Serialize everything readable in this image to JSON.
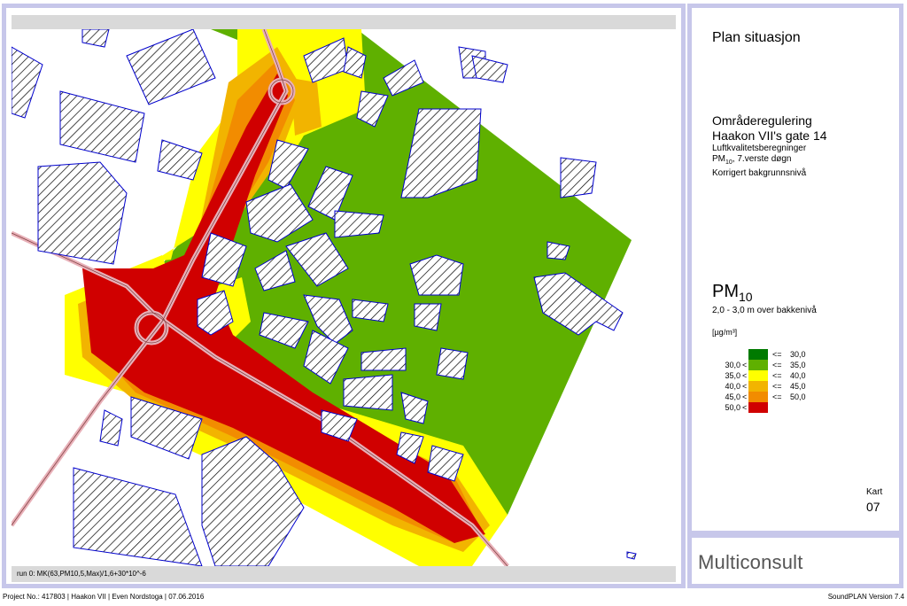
{
  "map": {
    "run_label": "run 0: MK(63,PM10,5,Max)/1,6+30*10^-6",
    "colors": {
      "class_1": "#007a00",
      "class_2": "#5fb000",
      "class_3": "#ffff00",
      "class_4": "#f2b400",
      "class_5": "#f28c00",
      "class_6": "#d00000",
      "building_outline": "#0000cc",
      "road": "#e8b0b8"
    }
  },
  "info": {
    "plan_title": "Plan situasjon",
    "project_title_line1": "Områderegulering",
    "project_title_line2": "Haakon VII's gate 14",
    "subtitle1": "Luftkvalitetsberegninger",
    "subtitle2_main": "PM",
    "subtitle2_sub": "10",
    "subtitle2_rest": ", 7.verste døgn",
    "subtitle3": "Korrigert bakgrunnsnivå",
    "pm_main": "PM",
    "pm_sub": "10",
    "height": "2,0 - 3,0 m over bakkenivå",
    "unit": "[µg/m³]",
    "kart_label": "Kart",
    "kart_number": "07"
  },
  "legend": [
    {
      "low": "",
      "lt": "",
      "color": "#007a00",
      "le": "<=",
      "high": "30,0"
    },
    {
      "low": "30,0",
      "lt": "<",
      "color": "#5fb000",
      "le": "<=",
      "high": "35,0"
    },
    {
      "low": "35,0",
      "lt": "<",
      "color": "#ffff00",
      "le": "<=",
      "high": "40,0"
    },
    {
      "low": "40,0",
      "lt": "<",
      "color": "#f2b400",
      "le": "<=",
      "high": "45,0"
    },
    {
      "low": "45,0",
      "lt": "<",
      "color": "#f28c00",
      "le": "<=",
      "high": "50,0"
    },
    {
      "low": "50,0",
      "lt": "<",
      "color": "#d00000",
      "le": "",
      "high": ""
    }
  ],
  "logo": "Multiconsult",
  "footer": {
    "left": "Project No.: 417803 | Haakon VII | Even Nordstoga | 07.06.2016",
    "right": "SoundPLAN Version 7.4"
  }
}
